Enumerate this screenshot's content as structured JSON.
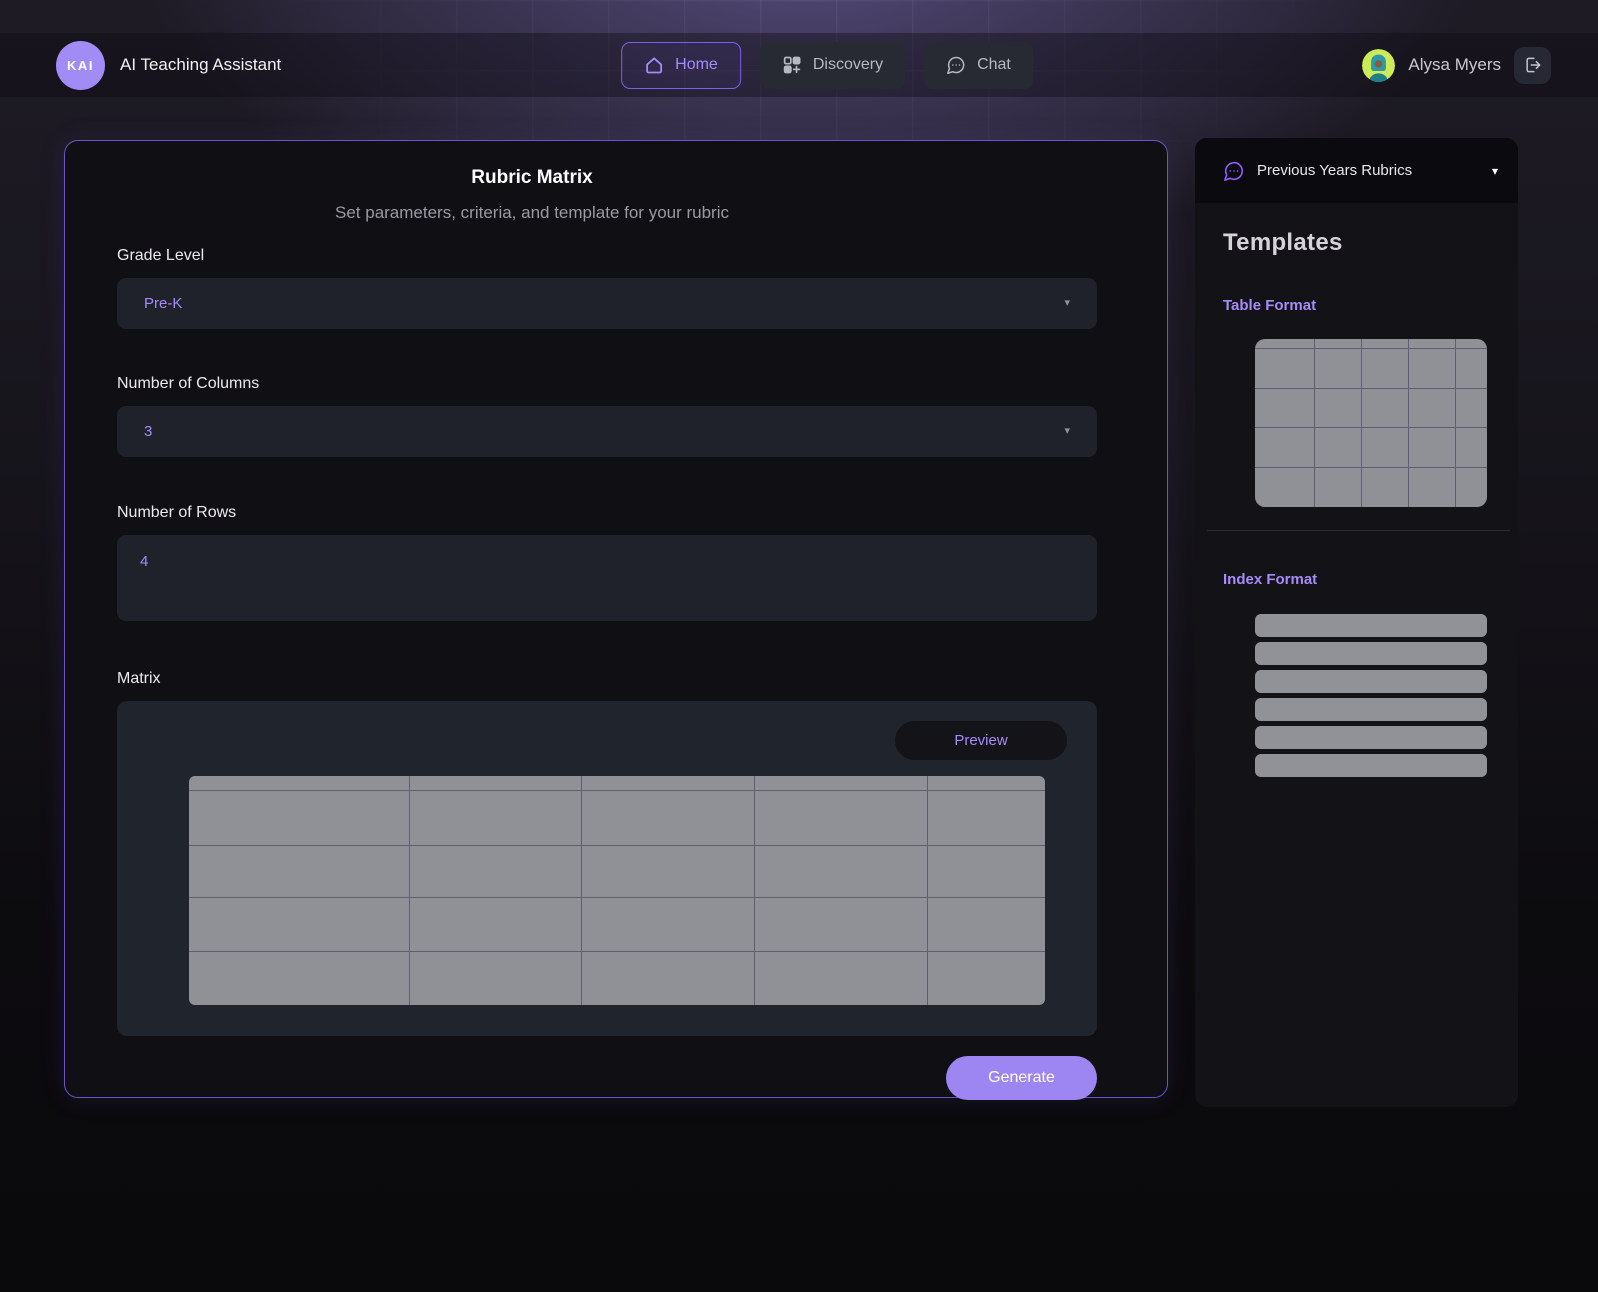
{
  "header": {
    "logo_text": "KAI",
    "app_title": "AI Teaching Assistant",
    "nav": [
      {
        "label": "Home",
        "active": true
      },
      {
        "label": "Discovery",
        "active": false
      },
      {
        "label": "Chat",
        "active": false
      }
    ],
    "user_name": "Alysa Myers"
  },
  "main": {
    "title": "Rubric Matrix",
    "subtitle": "Set parameters, criteria, and template for your rubric",
    "grade_level": {
      "label": "Grade Level",
      "value": "Pre-K"
    },
    "columns": {
      "label": "Number of Columns",
      "value": "3"
    },
    "rows": {
      "label": "Number of Rows",
      "value": "4"
    },
    "matrix": {
      "label": "Matrix",
      "preview_label": "Preview"
    },
    "generate_label": "Generate"
  },
  "sidebar": {
    "dropdown_label": "Previous Years Rubrics",
    "title": "Templates",
    "sections": [
      {
        "label": "Table Format",
        "type": "grid"
      },
      {
        "label": "Index Format",
        "type": "bars"
      }
    ]
  },
  "icons": {
    "caret_down": "▾"
  },
  "colors": {
    "accent_purple": "#a78bfa",
    "generate_purple": "#9e86f2",
    "panel_border_purple": "#6c55c8",
    "grid_gray": "#909197",
    "input_bg": "#1f222b"
  }
}
